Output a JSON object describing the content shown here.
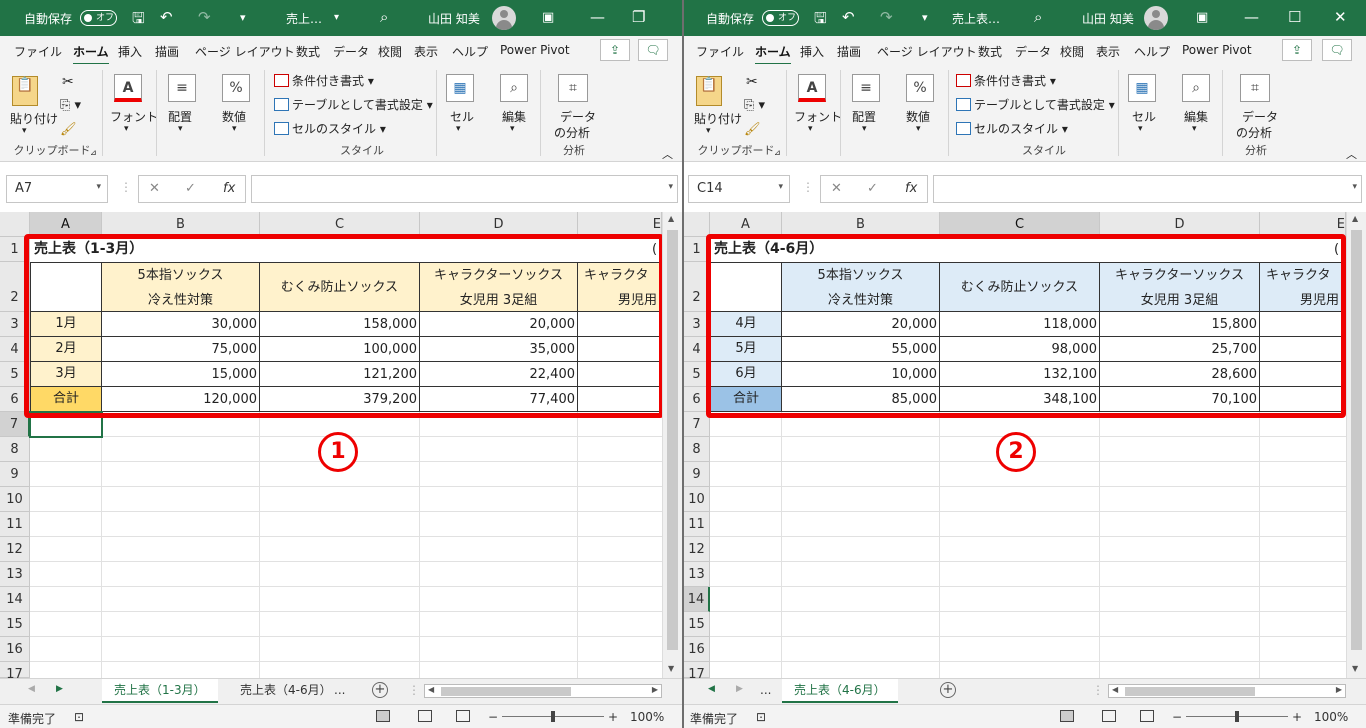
{
  "ribbon": {
    "autosave_label": "自動保存",
    "autosave_state": "オフ",
    "user_name": "山田 知美",
    "tabs": [
      "ファイル",
      "ホーム",
      "挿入",
      "描画",
      "ページ レイアウト",
      "数式",
      "データ",
      "校閲",
      "表示",
      "ヘルプ",
      "Power Pivot"
    ],
    "clipboard": {
      "paste": "貼り付け",
      "group": "クリップボード"
    },
    "font": "フォント",
    "alignment": "配置",
    "number": "数値",
    "styles": {
      "conditional": "条件付き書式",
      "table": "テーブルとして書式設定",
      "cell": "セルのスタイル",
      "group": "スタイル"
    },
    "cells": "セル",
    "editing": "編集",
    "analysis": {
      "button_line1": "データ",
      "button_line2": "の分析",
      "group": "分析"
    }
  },
  "status": {
    "ready": "準備完了",
    "zoom": "100%"
  },
  "columns": [
    "A",
    "B",
    "C",
    "D",
    "E"
  ],
  "rows": [
    "1",
    "2",
    "3",
    "4",
    "5",
    "6",
    "7",
    "8",
    "9",
    "10",
    "11",
    "12",
    "13",
    "14",
    "15",
    "16",
    "17"
  ],
  "headers": {
    "b1": "5本指ソックス",
    "b2": "冷え性対策",
    "c": "むくみ防止ソックス",
    "d1": "キャラクターソックス",
    "d2": "女児用 3足組",
    "e1": "キャラクタ",
    "e2": "男児用"
  },
  "windows": [
    {
      "title": "売上…",
      "namebox": "A7",
      "table_title": "売上表（1-3月）",
      "months": [
        "1月",
        "2月",
        "3月",
        "合計"
      ],
      "b": [
        "30,000",
        "75,000",
        "15,000",
        "120,000"
      ],
      "c": [
        "158,000",
        "100,000",
        "121,200",
        "379,200"
      ],
      "d": [
        "20,000",
        "35,000",
        "22,400",
        "77,400"
      ],
      "marker": "1",
      "sheet_tabs": [
        "売上表（1-3月）",
        "売上表（4-6月）",
        "..."
      ],
      "header_color": "#fff2cc",
      "total_color": "#ffd966"
    },
    {
      "title": "売上表…",
      "namebox": "C14",
      "table_title": "売上表（4-6月）",
      "months": [
        "4月",
        "5月",
        "6月",
        "合計"
      ],
      "b": [
        "20,000",
        "55,000",
        "10,000",
        "85,000"
      ],
      "c": [
        "118,000",
        "98,000",
        "132,100",
        "348,100"
      ],
      "d": [
        "15,800",
        "25,700",
        "28,600",
        "70,100"
      ],
      "marker": "2",
      "sheet_tabs": [
        "...",
        "売上表（4-6月）"
      ],
      "header_color": "#ddebf7",
      "total_color": "#9bc2e6"
    }
  ]
}
